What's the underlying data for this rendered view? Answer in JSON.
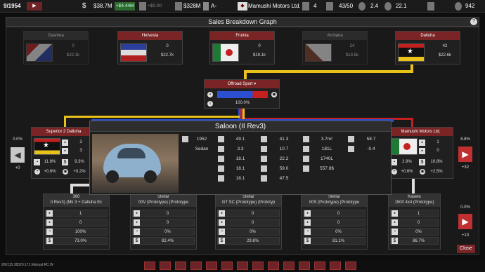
{
  "topbar": {
    "date": "9/1954",
    "play": "▶",
    "cash": "$38.7M",
    "cash_delta": "+$4.44M",
    "zero": "+$0.00",
    "assets": "$328M",
    "grade": "A-",
    "company": "Mamushi Motors Ltd.",
    "v1": "4",
    "v2": "43/50",
    "v3": "2.4",
    "v4": "22.1",
    "v5": "942"
  },
  "window": {
    "title": "Sales Breakdown Graph",
    "help": "?",
    "close": "Close"
  },
  "countries": [
    {
      "name": "Gasmea",
      "v1": "0",
      "v2": "$22.1k"
    },
    {
      "name": "Hetvesia",
      "v1": "0",
      "v2": "$22.7k"
    },
    {
      "name": "Fruinia",
      "v1": "0",
      "v2": "$19.1k"
    },
    {
      "name": "Archana",
      "v1": "24",
      "v2": "$13.5k"
    },
    {
      "name": "Dalluha",
      "v1": "42",
      "v2": "$22.6k"
    }
  ],
  "segment": {
    "name": "Offroad Sport",
    "pct": "100.0%"
  },
  "left_company": {
    "name": "Superior 2 Dalluha",
    "a": "3",
    "b": "3",
    "c": "11.8%",
    "d": "9.3%",
    "e": "+0.6%",
    "f": "+0.2%"
  },
  "right_company": {
    "name": "Mamushi Motors Ltd.",
    "a": "1",
    "b": "0",
    "c": "2.9%",
    "d": "10.8%",
    "e": "+0.6%",
    "f": "+2.5%"
  },
  "side": {
    "left_top": "0.0%",
    "left_bottom": "+0",
    "right_top": "8.8%",
    "right_bottom": "+32",
    "br_top": "0.0%",
    "br_bottom": "+10"
  },
  "popup": {
    "title": "Saloon (II Rev3)",
    "year": "1952",
    "body": "Sedan",
    "c1": [
      "49.1",
      "3.3",
      "18.1",
      "18.1",
      "18.1"
    ],
    "c2": [
      "41.3",
      "10.7",
      "22.2",
      "59.0",
      "47.5"
    ],
    "c3": [
      "3.7m²",
      "181L",
      "1740L",
      "557.8$"
    ],
    "c4": [
      "58.7",
      "-0.4"
    ]
  },
  "cars": [
    {
      "brand": "360",
      "model": "II Rev3) (Mk 3 + Dalluha Ec",
      "r": [
        "1",
        "0",
        "100%",
        "73.0%"
      ]
    },
    {
      "brand": "Stellar",
      "model": "00V (Prototype) (Prototype",
      "r": [
        "0",
        "0",
        "0%",
        "82.4%"
      ]
    },
    {
      "brand": "Stellar",
      "model": "GT SC (Prototype) (Prototyp",
      "r": [
        "0",
        "0",
        "0%",
        "29.8%"
      ]
    },
    {
      "brand": "Stellar",
      "model": "00S (Prototype) (Prototype",
      "r": [
        "0",
        "0",
        "0%",
        "81.1%"
      ]
    },
    {
      "brand": "Kasete",
      "model": "1500 4x4 (Prototype)",
      "r": [
        "1",
        "0",
        "0%",
        "86.7%"
      ]
    }
  ],
  "version": "260115.38329.171.Manual.RC.W",
  "colors": {
    "accent": "#7a2426",
    "yellow": "#e8c21b",
    "blue": "#2b4fd0",
    "red": "#c42020"
  }
}
